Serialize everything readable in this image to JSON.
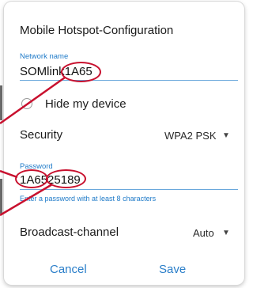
{
  "dialog": {
    "title": "Mobile Hotspot-Configuration",
    "network_name": {
      "label": "Network name",
      "value_prefix": "SOMlink",
      "value_suffix": "1A65"
    },
    "hide_device": {
      "label": "Hide my device",
      "checked": false
    },
    "security": {
      "label": "Security",
      "value": "WPA2 PSK"
    },
    "password": {
      "label": "Password",
      "value_part1": "1A65",
      "value_part2": "25189",
      "hint": "Enter a password with at least 8 characters"
    },
    "broadcast_channel": {
      "label": "Broadcast-channel",
      "value": "Auto"
    },
    "buttons": {
      "cancel": "Cancel",
      "save": "Save"
    }
  },
  "colors": {
    "accent": "#1e7ac8",
    "annotation": "#c8102e"
  }
}
